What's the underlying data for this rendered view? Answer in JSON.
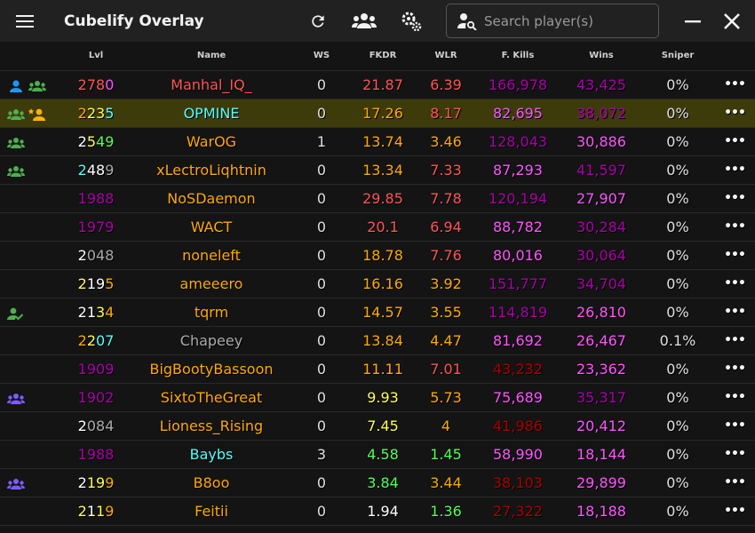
{
  "window": {
    "title": "Cubelify Overlay",
    "search_placeholder": "Search player(s)",
    "menu_icon": "menu-icon",
    "refresh_icon": "refresh-icon",
    "friends_icon": "group-add-icon",
    "settings_icon": "gear-icon",
    "search_icon": "person-search-icon",
    "minimize_icon": "minimize-icon",
    "close_icon": "close-icon"
  },
  "columns": [
    "Lvl",
    "Name",
    "WS",
    "FKDR",
    "WLR",
    "F. Kills",
    "Wins",
    "Sniper"
  ],
  "players": [
    {
      "icons": [
        "person-blue",
        "group-green"
      ],
      "lvl": "2780",
      "name": "Manhal_IQ_",
      "ws": "0",
      "fkdr": "21.87",
      "wlr": "6.39",
      "fkills": "166,978",
      "wins": "43,425",
      "sniper": "0%"
    },
    {
      "icons": [
        "group-green",
        "person-star-orange"
      ],
      "lvl": "2235",
      "name": "OPMINE",
      "ws": "0",
      "fkdr": "17.26",
      "wlr": "8.17",
      "fkills": "82,695",
      "wins": "38,072",
      "sniper": "0%"
    },
    {
      "icons": [
        "group-green"
      ],
      "lvl": "2549",
      "name": "WarOG",
      "ws": "1",
      "fkdr": "13.74",
      "wlr": "3.46",
      "fkills": "128,043",
      "wins": "30,886",
      "sniper": "0%"
    },
    {
      "icons": [
        "group-green"
      ],
      "lvl": "2489",
      "name": "xLectroLiqhtnin",
      "ws": "0",
      "fkdr": "13.34",
      "wlr": "7.33",
      "fkills": "87,293",
      "wins": "41,597",
      "sniper": "0%"
    },
    {
      "icons": [],
      "lvl": "1988",
      "name": "NoSDaemon",
      "ws": "0",
      "fkdr": "29.85",
      "wlr": "7.78",
      "fkills": "120,194",
      "wins": "27,907",
      "sniper": "0%"
    },
    {
      "icons": [],
      "lvl": "1979",
      "name": "WACT",
      "ws": "0",
      "fkdr": "20.1",
      "wlr": "6.94",
      "fkills": "88,782",
      "wins": "30,284",
      "sniper": "0%"
    },
    {
      "icons": [],
      "lvl": "2048",
      "name": "noneleft",
      "ws": "0",
      "fkdr": "18.78",
      "wlr": "7.76",
      "fkills": "80,016",
      "wins": "30,064",
      "sniper": "0%"
    },
    {
      "icons": [],
      "lvl": "2195",
      "name": "ameeero",
      "ws": "0",
      "fkdr": "16.16",
      "wlr": "3.92",
      "fkills": "151,777",
      "wins": "34,704",
      "sniper": "0%"
    },
    {
      "icons": [
        "person-check-green"
      ],
      "lvl": "2134",
      "name": "tqrm",
      "ws": "0",
      "fkdr": "14.57",
      "wlr": "3.55",
      "fkills": "114,819",
      "wins": "26,810",
      "sniper": "0%"
    },
    {
      "icons": [],
      "lvl": "2207",
      "name": "Chapeey",
      "ws": "0",
      "fkdr": "13.84",
      "wlr": "4.47",
      "fkills": "81,692",
      "wins": "26,467",
      "sniper": "0.1%"
    },
    {
      "icons": [],
      "lvl": "1909",
      "name": "BigBootyBassoon",
      "ws": "0",
      "fkdr": "11.11",
      "wlr": "7.01",
      "fkills": "43,232",
      "wins": "23,362",
      "sniper": "0%"
    },
    {
      "icons": [
        "group-purple"
      ],
      "lvl": "1902",
      "name": "SixtoTheGreat",
      "ws": "0",
      "fkdr": "9.93",
      "wlr": "5.73",
      "fkills": "75,689",
      "wins": "35,317",
      "sniper": "0%"
    },
    {
      "icons": [],
      "lvl": "2084",
      "name": "Lioness_Rising",
      "ws": "0",
      "fkdr": "7.45",
      "wlr": "4",
      "fkills": "41,986",
      "wins": "20,412",
      "sniper": "0%"
    },
    {
      "icons": [],
      "lvl": "1988",
      "name": "Baybs",
      "ws": "3",
      "fkdr": "4.58",
      "wlr": "1.45",
      "fkills": "58,990",
      "wins": "18,144",
      "sniper": "0%"
    },
    {
      "icons": [
        "group-purple"
      ],
      "lvl": "2199",
      "name": "B8oo",
      "ws": "0",
      "fkdr": "3.84",
      "wlr": "3.44",
      "fkills": "38,103",
      "wins": "29,899",
      "sniper": "0%"
    },
    {
      "icons": [],
      "lvl": "2119",
      "name": "Feitii",
      "ws": "0",
      "fkdr": "1.94",
      "wlr": "1.36",
      "fkills": "27,322",
      "wins": "18,188",
      "sniper": "0%"
    }
  ],
  "row_more_label": "•••",
  "colors": {
    "titlebar": "#212121",
    "background": "#141414",
    "highlight_row": "#3e3b0b",
    "red": "#ff5555",
    "gold": "#ffaa00",
    "yellow": "#ffff55",
    "green": "#55ff55",
    "aqua": "#55ffff",
    "pink": "#ff55ff",
    "purple": "#aa00aa",
    "dark_red": "#aa0000",
    "gray": "#aaaaaa",
    "white": "#ffffff"
  },
  "highlighted_player": "OPMINE"
}
